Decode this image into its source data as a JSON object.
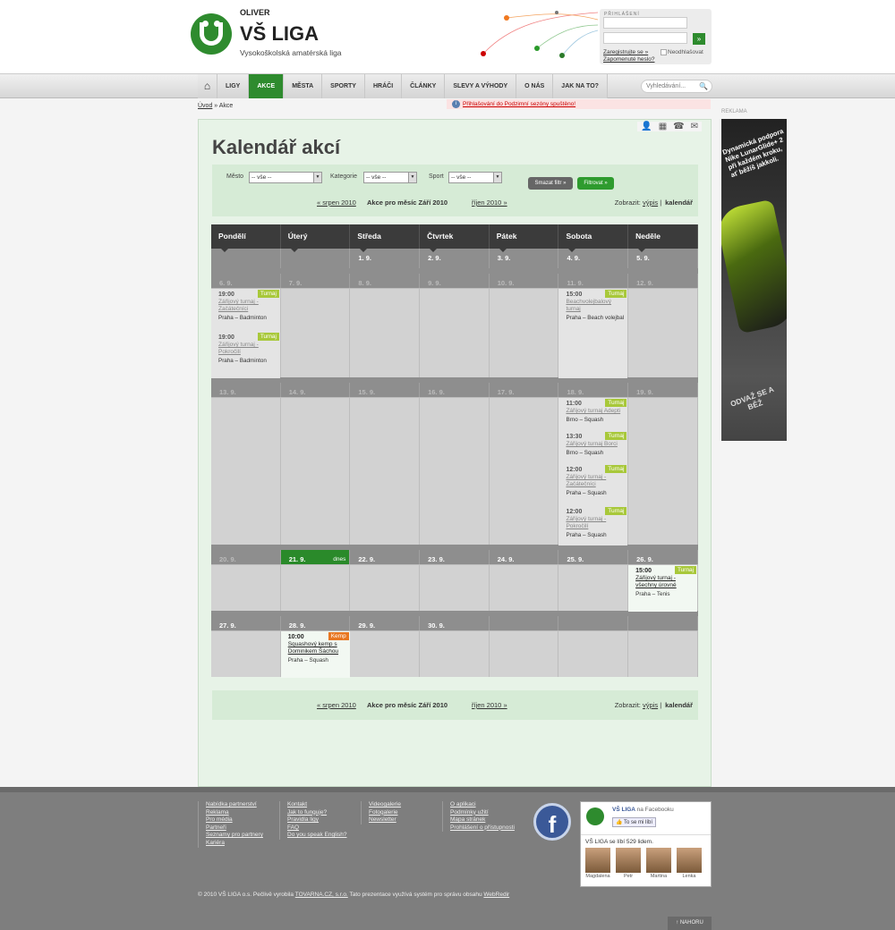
{
  "header": {
    "oliver": "OLIVER",
    "brand": "VŠ LIGA",
    "tagline": "Vysokoškolská amatérská liga",
    "login": {
      "label": "PŘIHLÁŠENÍ",
      "submit": "»",
      "register": "Zaregistrujte se »",
      "forgot": "Zapomenuté heslo?",
      "stay": "Neodhlašovat"
    }
  },
  "nav": {
    "home_icon": "home-icon",
    "items": [
      "LIGY",
      "AKCE",
      "MĚSTA",
      "SPORTY",
      "HRÁČI",
      "ČLÁNKY",
      "SLEVY A VÝHODY",
      "O NÁS",
      "JAK NA TO?"
    ],
    "active": "AKCE",
    "search_placeholder": "Vyhledávání...",
    "search_icon": "🔍"
  },
  "breadcrumb": {
    "home": "Úvod",
    "sep": " » ",
    "current": "Akce"
  },
  "notice": {
    "icon": "i",
    "text": "Přihlašování do Podzimní sezóny spuštěno!"
  },
  "ad": {
    "label": "REKLAMA",
    "text1": "Dynamická podpora Nike LunarGlide+ 2 při každém kroku, ať běžíš jakkoli.",
    "text2": "ODVAŽ SE A BĚŽ"
  },
  "page": {
    "title": "Kalendář akcí",
    "tools": [
      "👤",
      "▦",
      "☎",
      "✉"
    ],
    "filter": {
      "city_label": "Město",
      "city_value": "-- vše --",
      "category_label": "Kategorie",
      "category_value": "-- vše --",
      "sport_label": "Sport",
      "sport_value": "-- vše --",
      "clear": "Smazat filtr »",
      "apply": "Filtrovat »"
    },
    "month_nav": {
      "prev": "« srpen 2010",
      "current": "Akce pro měsíc Září 2010",
      "next": "říjen 2010 »",
      "view_label": "Zobrazit:",
      "view_list": "výpis",
      "view_sep": "|",
      "view_calendar": "kalendář"
    }
  },
  "calendar": {
    "days": [
      "Pondělí",
      "Úterý",
      "Středa",
      "Čtvrtek",
      "Pátek",
      "Sobota",
      "Neděle"
    ],
    "weeks": [
      {
        "dates": [
          "",
          "",
          "1. 9.",
          "2. 9.",
          "3. 9.",
          "4. 9.",
          "5. 9."
        ]
      },
      {
        "dates": [
          "6. 9.",
          "7. 9.",
          "8. 9.",
          "9. 9.",
          "10. 9.",
          "11. 9.",
          "12. 9."
        ]
      },
      {
        "dates": [
          "13. 9.",
          "14. 9.",
          "15. 9.",
          "16. 9.",
          "17. 9.",
          "18. 9.",
          "19. 9."
        ]
      },
      {
        "dates": [
          "20. 9.",
          "21. 9.",
          "22. 9.",
          "23. 9.",
          "24. 9.",
          "25. 9.",
          "26. 9."
        ],
        "today_label": "dnes"
      },
      {
        "dates": [
          "27. 9.",
          "28. 9.",
          "29. 9.",
          "30. 9.",
          "",
          "",
          ""
        ]
      }
    ],
    "events": [
      {
        "time": "19:00",
        "tag": "Turnaj",
        "title": "Zářijový turnaj - Začátečníci",
        "loc": "Praha – Badminton"
      },
      {
        "time": "19:00",
        "tag": "Turnaj",
        "title": "Zářijový turnaj - Pokročilí",
        "loc": "Praha – Badminton"
      },
      {
        "time": "15:00",
        "tag": "Turnaj",
        "title": "Beachvolejbalový turnaj",
        "loc": "Praha – Beach volejbal"
      },
      {
        "time": "11:00",
        "tag": "Turnaj",
        "title": "Zářijový turnaj Adepti",
        "loc": "Brno – Squash"
      },
      {
        "time": "13:30",
        "tag": "Turnaj",
        "title": "Zářijový turnaj Borci",
        "loc": "Brno – Squash"
      },
      {
        "time": "12:00",
        "tag": "Turnaj",
        "title": "Zářijový turnaj - Začátečníci",
        "loc": "Praha – Squash"
      },
      {
        "time": "12:00",
        "tag": "Turnaj",
        "title": "Zářijový turnaj - Pokročilí",
        "loc": "Praha – Squash"
      },
      {
        "time": "15:00",
        "tag": "Turnaj",
        "title": "Zářijový turnaj - všechny úrovně",
        "loc": "Praha – Tenis"
      },
      {
        "time": "10:00",
        "tag": "Kemp",
        "title": "Squashový kemp s Dominikem Šáchou",
        "loc": "Praha – Squash"
      }
    ]
  },
  "footer": {
    "col1": [
      "Nabídka partnerství",
      "Reklama",
      "Pro média",
      "Partneři",
      "Seznamy pro partnery",
      "Kariéra"
    ],
    "col2": [
      "Kontakt",
      "Jak to funguje?",
      "Pravidla ligy",
      "FAQ",
      "Do you speak English?"
    ],
    "col3": [
      "Videogalerie",
      "Fotogalerie",
      "Newsletter"
    ],
    "col4": [
      "O aplikaci",
      "Podmínky užití",
      "Mapa stránek",
      "Prohlášení o přístupnosti"
    ],
    "fb_badge": "f",
    "fb": {
      "name": "VŠ LIGA",
      "on": "na Facebooku",
      "like": "👍 To se mi líbí",
      "count": "VŠ LIGA se líbí 529 lidem.",
      "faces": [
        "Magdalena",
        "Petr",
        "Martina",
        "Lenka"
      ]
    },
    "copy": {
      "pre": "© 2010 VŠ LIGA o.s.    Pečlivě vyrobila",
      "agency": "TOVARNA.CZ, s.r.o.",
      "mid": "   Tato prezentace využívá systém pro správu obsahu",
      "cms": "WebRedir"
    },
    "totop": "↑ NAHORU"
  }
}
